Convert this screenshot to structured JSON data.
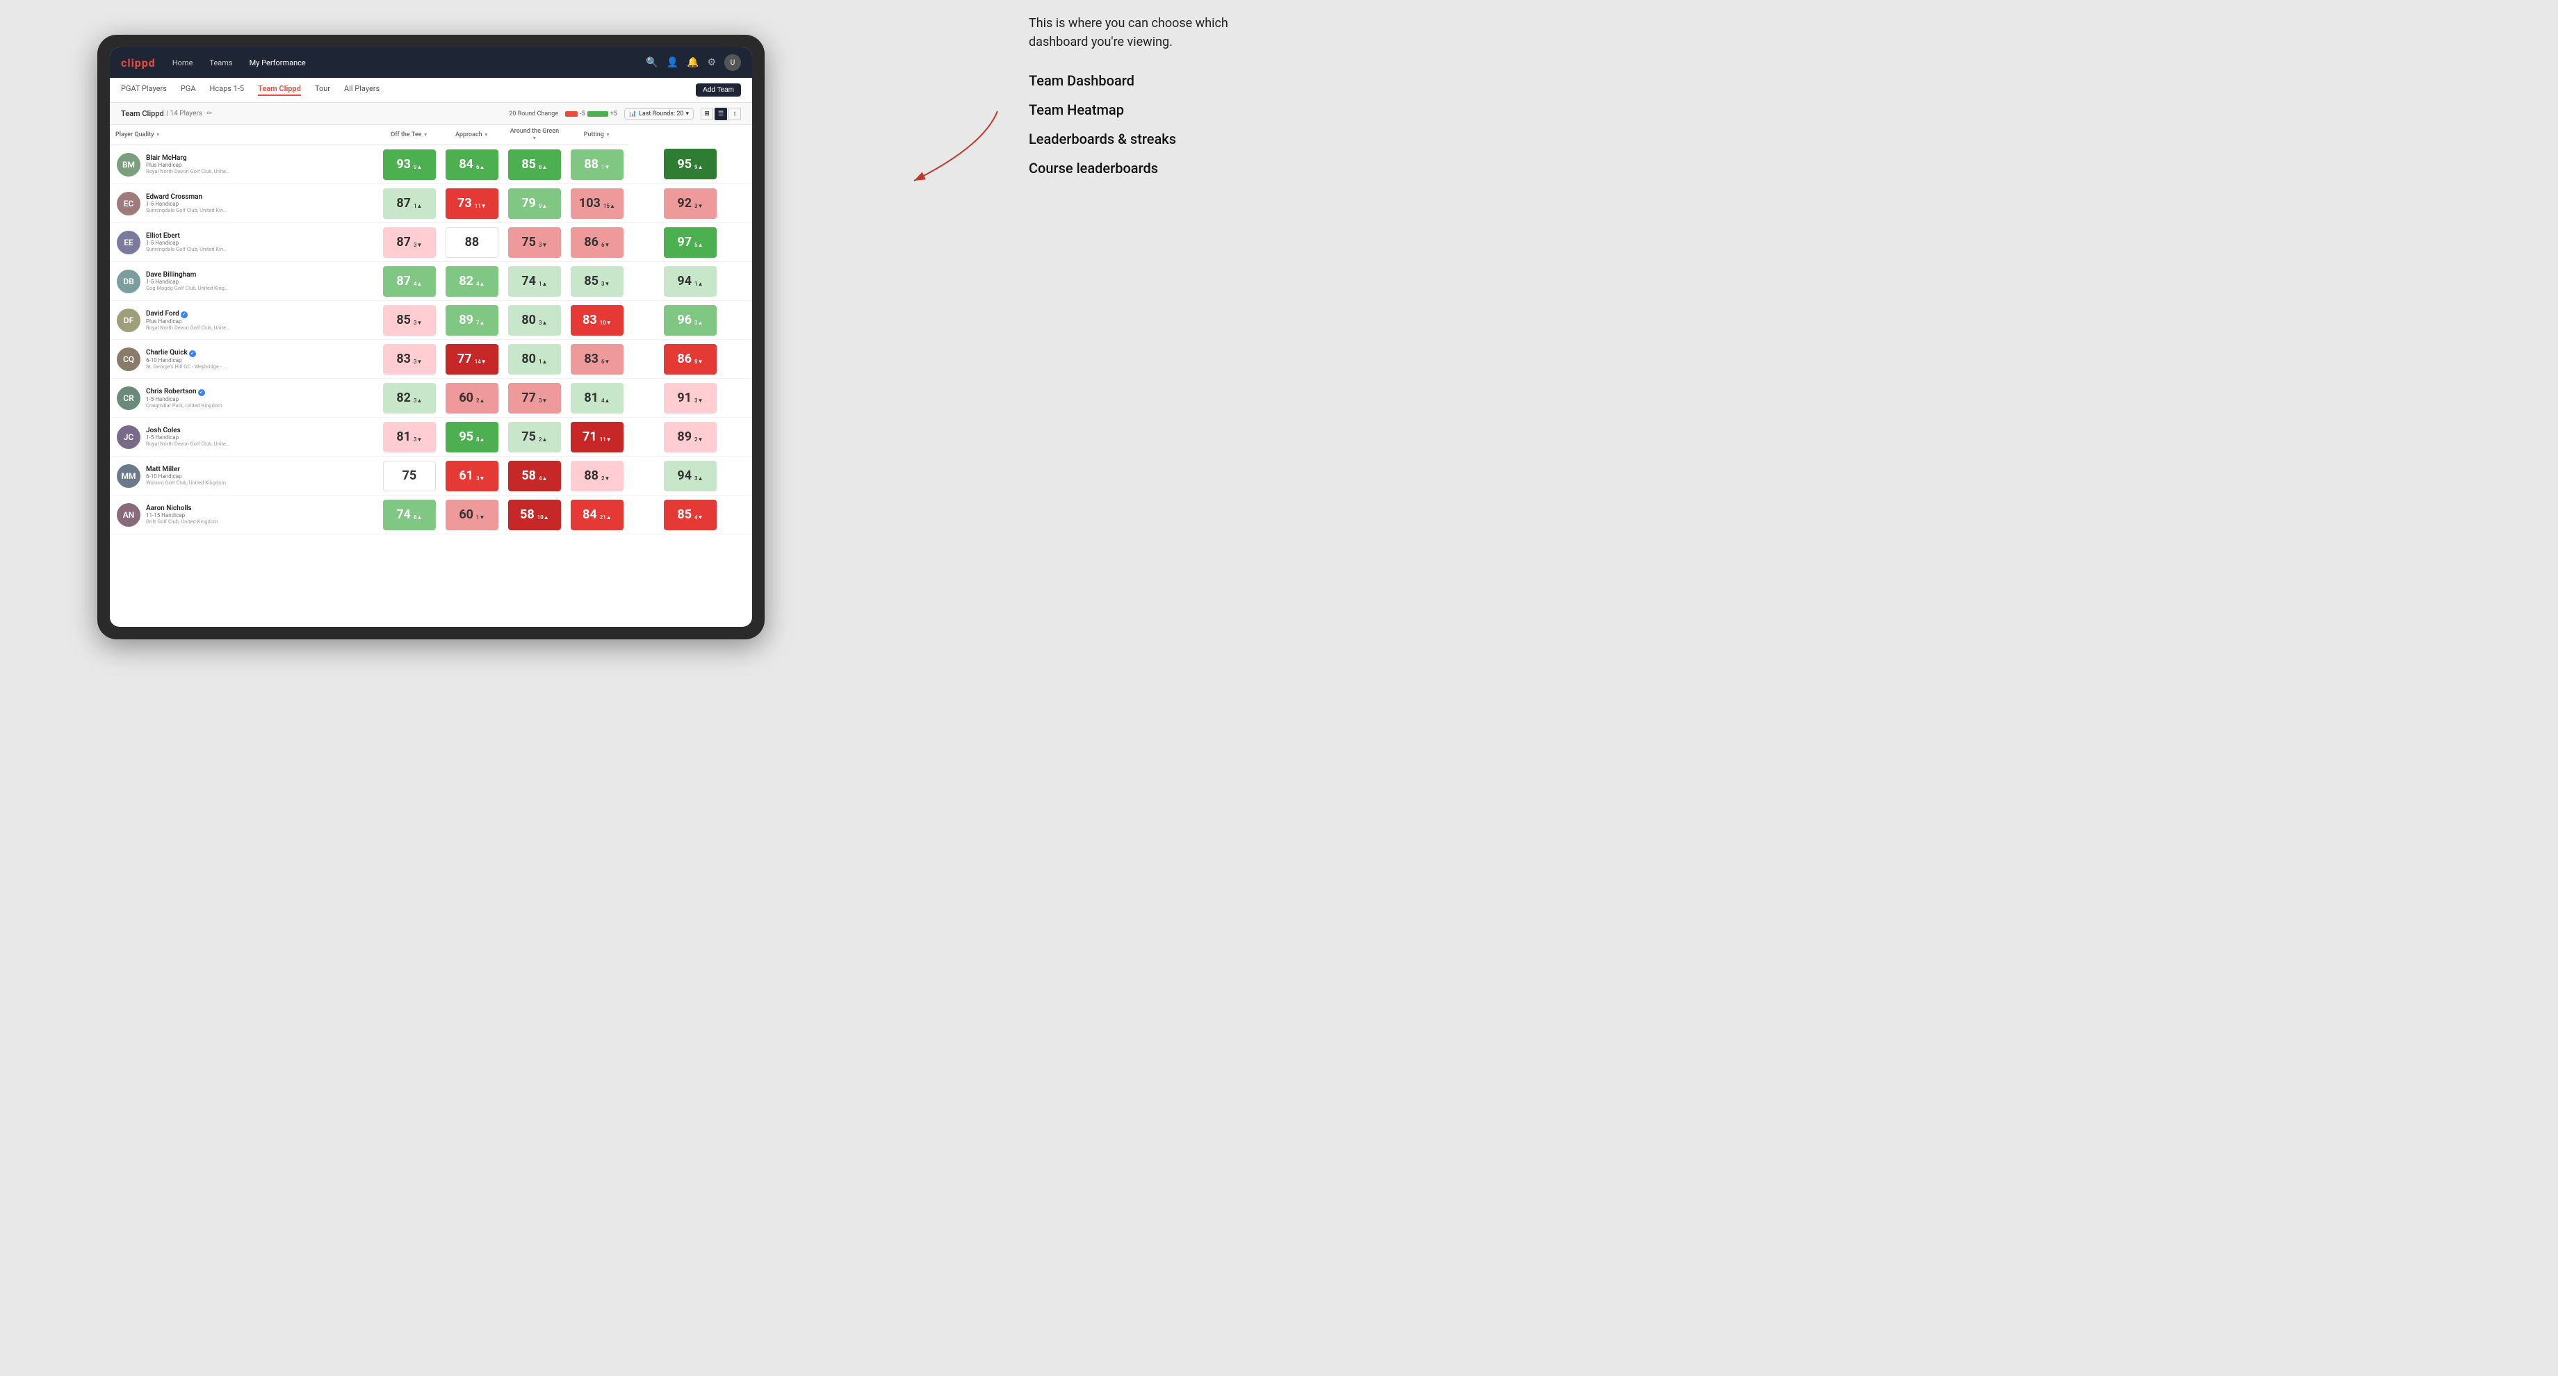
{
  "annotation": {
    "intro": "This is where you can choose which dashboard you're viewing.",
    "menu_items": [
      "Team Dashboard",
      "Team Heatmap",
      "Leaderboards & streaks",
      "Course leaderboards"
    ]
  },
  "navbar": {
    "logo": "clippd",
    "links": [
      "Home",
      "Teams",
      "My Performance"
    ],
    "active_link": "My Performance",
    "icons": [
      "search",
      "person",
      "bell",
      "settings",
      "avatar"
    ]
  },
  "subnav": {
    "links": [
      "PGAT Players",
      "PGA",
      "Hcaps 1-5",
      "Team Clippd",
      "Tour",
      "All Players"
    ],
    "active_link": "Team Clippd",
    "add_button": "Add Team"
  },
  "team_header": {
    "name": "Team Clippd",
    "separator": "|",
    "count": "14 Players",
    "round_change_label": "20 Round Change",
    "bar_neg": "-5",
    "bar_pos": "+5",
    "last_rounds_label": "Last Rounds:",
    "last_rounds_value": "20"
  },
  "table": {
    "columns": [
      "Player Quality ↓",
      "Off the Tee ↓",
      "Approach ↓",
      "Around the Green ↓",
      "Putting ↓"
    ],
    "players": [
      {
        "name": "Blair McHarg",
        "handicap": "Plus Handicap",
        "club": "Royal North Devon Golf Club, United Kingdom",
        "avatar_color": "#7a9e7e",
        "initials": "BM",
        "scores": [
          {
            "value": "93",
            "change": "9▲",
            "color": "green-mid"
          },
          {
            "value": "84",
            "change": "6▲",
            "color": "green-mid"
          },
          {
            "value": "85",
            "change": "8▲",
            "color": "green-mid"
          },
          {
            "value": "88",
            "change": "1▼",
            "color": "green-light"
          },
          {
            "value": "95",
            "change": "9▲",
            "color": "green-dark"
          }
        ]
      },
      {
        "name": "Edward Crossman",
        "handicap": "1-5 Handicap",
        "club": "Sunningdale Golf Club, United Kingdom",
        "avatar_color": "#9e7a7a",
        "initials": "EC",
        "scores": [
          {
            "value": "87",
            "change": "1▲",
            "color": "green-pale"
          },
          {
            "value": "73",
            "change": "11▼",
            "color": "red-mid"
          },
          {
            "value": "79",
            "change": "9▲",
            "color": "green-light"
          },
          {
            "value": "103",
            "change": "15▲",
            "color": "red-light"
          },
          {
            "value": "92",
            "change": "3▼",
            "color": "red-light"
          }
        ]
      },
      {
        "name": "Elliot Ebert",
        "handicap": "1-5 Handicap",
        "club": "Sunningdale Golf Club, United Kingdom",
        "avatar_color": "#7a7a9e",
        "initials": "EE",
        "scores": [
          {
            "value": "87",
            "change": "3▼",
            "color": "red-pale"
          },
          {
            "value": "88",
            "change": "",
            "color": "neutral"
          },
          {
            "value": "75",
            "change": "3▼",
            "color": "red-light"
          },
          {
            "value": "86",
            "change": "6▼",
            "color": "red-light"
          },
          {
            "value": "97",
            "change": "5▲",
            "color": "green-mid"
          }
        ]
      },
      {
        "name": "Dave Billingham",
        "handicap": "1-5 Handicap",
        "club": "Gog Magog Golf Club, United Kingdom",
        "avatar_color": "#7a9e9e",
        "initials": "DB",
        "scores": [
          {
            "value": "87",
            "change": "4▲",
            "color": "green-light"
          },
          {
            "value": "82",
            "change": "4▲",
            "color": "green-light"
          },
          {
            "value": "74",
            "change": "1▲",
            "color": "green-pale"
          },
          {
            "value": "85",
            "change": "3▼",
            "color": "green-pale"
          },
          {
            "value": "94",
            "change": "1▲",
            "color": "green-pale"
          }
        ]
      },
      {
        "name": "David Ford",
        "handicap": "Plus Handicap",
        "club": "Royal North Devon Golf Club, United Kingdom",
        "avatar_color": "#9e9e7a",
        "initials": "DF",
        "verified": true,
        "scores": [
          {
            "value": "85",
            "change": "3▼",
            "color": "red-pale"
          },
          {
            "value": "89",
            "change": "7▲",
            "color": "green-light"
          },
          {
            "value": "80",
            "change": "3▲",
            "color": "green-pale"
          },
          {
            "value": "83",
            "change": "10▼",
            "color": "red-mid"
          },
          {
            "value": "96",
            "change": "3▲",
            "color": "green-light"
          }
        ]
      },
      {
        "name": "Charlie Quick",
        "handicap": "6-10 Handicap",
        "club": "St. George's Hill GC - Weybridge - Surrey, Uni...",
        "avatar_color": "#8a7a6a",
        "initials": "CQ",
        "verified": true,
        "scores": [
          {
            "value": "83",
            "change": "3▼",
            "color": "red-pale"
          },
          {
            "value": "77",
            "change": "14▼",
            "color": "red-dark"
          },
          {
            "value": "80",
            "change": "1▲",
            "color": "green-pale"
          },
          {
            "value": "83",
            "change": "6▼",
            "color": "red-light"
          },
          {
            "value": "86",
            "change": "8▼",
            "color": "red-mid"
          }
        ]
      },
      {
        "name": "Chris Robertson",
        "handicap": "1-5 Handicap",
        "club": "Craigmillar Park, United Kingdom",
        "avatar_color": "#6a8a7a",
        "initials": "CR",
        "verified": true,
        "scores": [
          {
            "value": "82",
            "change": "3▲",
            "color": "green-pale"
          },
          {
            "value": "60",
            "change": "2▲",
            "color": "red-light"
          },
          {
            "value": "77",
            "change": "3▼",
            "color": "red-light"
          },
          {
            "value": "81",
            "change": "4▲",
            "color": "green-pale"
          },
          {
            "value": "91",
            "change": "3▼",
            "color": "red-pale"
          }
        ]
      },
      {
        "name": "Josh Coles",
        "handicap": "1-5 Handicap",
        "club": "Royal North Devon Golf Club, United Kingdom",
        "avatar_color": "#7a6a8a",
        "initials": "JC",
        "scores": [
          {
            "value": "81",
            "change": "3▼",
            "color": "red-pale"
          },
          {
            "value": "95",
            "change": "8▲",
            "color": "green-mid"
          },
          {
            "value": "75",
            "change": "2▲",
            "color": "green-pale"
          },
          {
            "value": "71",
            "change": "11▼",
            "color": "red-dark"
          },
          {
            "value": "89",
            "change": "2▼",
            "color": "red-pale"
          }
        ]
      },
      {
        "name": "Matt Miller",
        "handicap": "6-10 Handicap",
        "club": "Woburn Golf Club, United Kingdom",
        "avatar_color": "#6a7a8a",
        "initials": "MM",
        "scores": [
          {
            "value": "75",
            "change": "",
            "color": "neutral"
          },
          {
            "value": "61",
            "change": "3▼",
            "color": "red-mid"
          },
          {
            "value": "58",
            "change": "4▲",
            "color": "red-dark"
          },
          {
            "value": "88",
            "change": "2▼",
            "color": "red-pale"
          },
          {
            "value": "94",
            "change": "3▲",
            "color": "green-pale"
          }
        ]
      },
      {
        "name": "Aaron Nicholls",
        "handicap": "11-15 Handicap",
        "club": "Drift Golf Club, United Kingdom",
        "avatar_color": "#8a6a7a",
        "initials": "AN",
        "scores": [
          {
            "value": "74",
            "change": "8▲",
            "color": "green-light"
          },
          {
            "value": "60",
            "change": "1▼",
            "color": "red-light"
          },
          {
            "value": "58",
            "change": "10▲",
            "color": "red-dark"
          },
          {
            "value": "84",
            "change": "21▲",
            "color": "red-mid"
          },
          {
            "value": "85",
            "change": "4▼",
            "color": "red-mid"
          }
        ]
      }
    ]
  }
}
